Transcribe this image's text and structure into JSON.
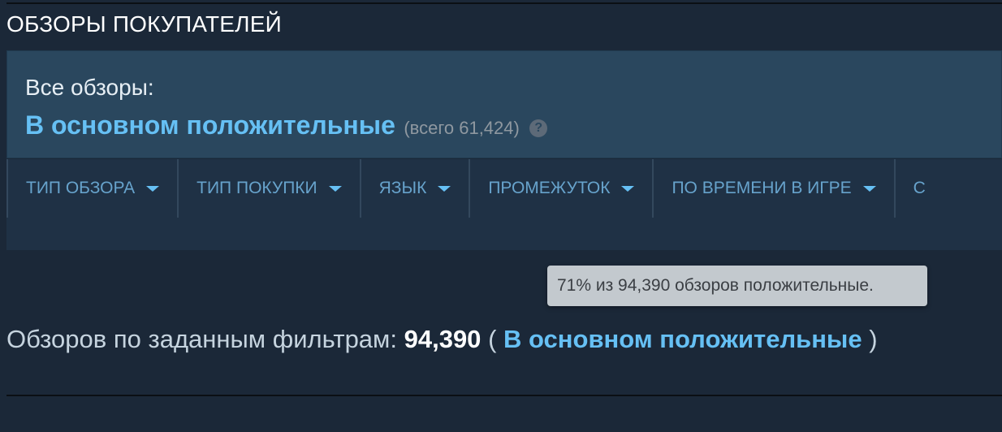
{
  "section": {
    "title": "ОБЗОРЫ ПОКУПАТЕЛЕЙ"
  },
  "summary": {
    "label": "Все обзоры:",
    "rating": "В основном положительные",
    "count_text": "(всего 61,424)",
    "help_glyph": "?"
  },
  "filters": [
    {
      "label": "ТИП ОБЗОРА"
    },
    {
      "label": "ТИП ПОКУПКИ"
    },
    {
      "label": "ЯЗЫК"
    },
    {
      "label": "ПРОМЕЖУТОК"
    },
    {
      "label": "ПО ВРЕМЕНИ В ИГРЕ"
    },
    {
      "label": "С"
    }
  ],
  "tooltip": {
    "text": "71% из 94,390 обзоров положительные."
  },
  "filtered": {
    "prefix": "Обзоров по заданным фильтрам:",
    "count": "94,390",
    "open_paren": "(",
    "rating": "В основном положительные",
    "close_paren": ")"
  },
  "icons": {
    "help": "question-mark-icon",
    "dropdown": "caret-down-icon"
  },
  "colors": {
    "background": "#1b2838",
    "panel": "#2a475e",
    "filter_bar": "#1f3145",
    "accent": "#66c0f4",
    "tooltip_bg": "#c3c9ce"
  }
}
